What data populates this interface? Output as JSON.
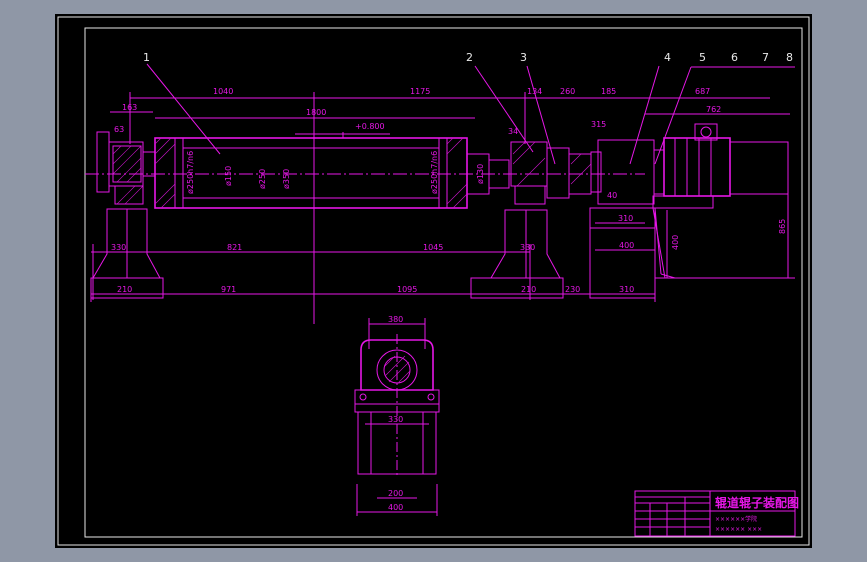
{
  "part_numbers": [
    "1",
    "2",
    "3",
    "4",
    "5",
    "6",
    "7",
    "8"
  ],
  "dimensions": {
    "top": [
      "1040",
      "1175",
      "1800",
      "134",
      "260",
      "185",
      "687",
      "762",
      "163",
      "63",
      "34",
      "315"
    ],
    "roller": [
      "+0.800",
      "ø250",
      "ø350",
      "ø150",
      "ø130",
      "ø250h7/n6",
      "ø250h7/n6"
    ],
    "middle": [
      "330",
      "821",
      "1045",
      "330",
      "310",
      "400",
      "40",
      "865"
    ],
    "bottom": [
      "210",
      "971",
      "1095",
      "210",
      "230",
      "310"
    ],
    "section": [
      "380",
      "330",
      "200",
      "400"
    ]
  },
  "title_block": {
    "title": "辊道辊子装配图",
    "line1": "××××××学院",
    "line2": "××××××  ×××"
  },
  "colors": {
    "line": "#e617e6",
    "frame": "#e8e8e8",
    "background": "#000000",
    "window": "#8f97a6"
  }
}
